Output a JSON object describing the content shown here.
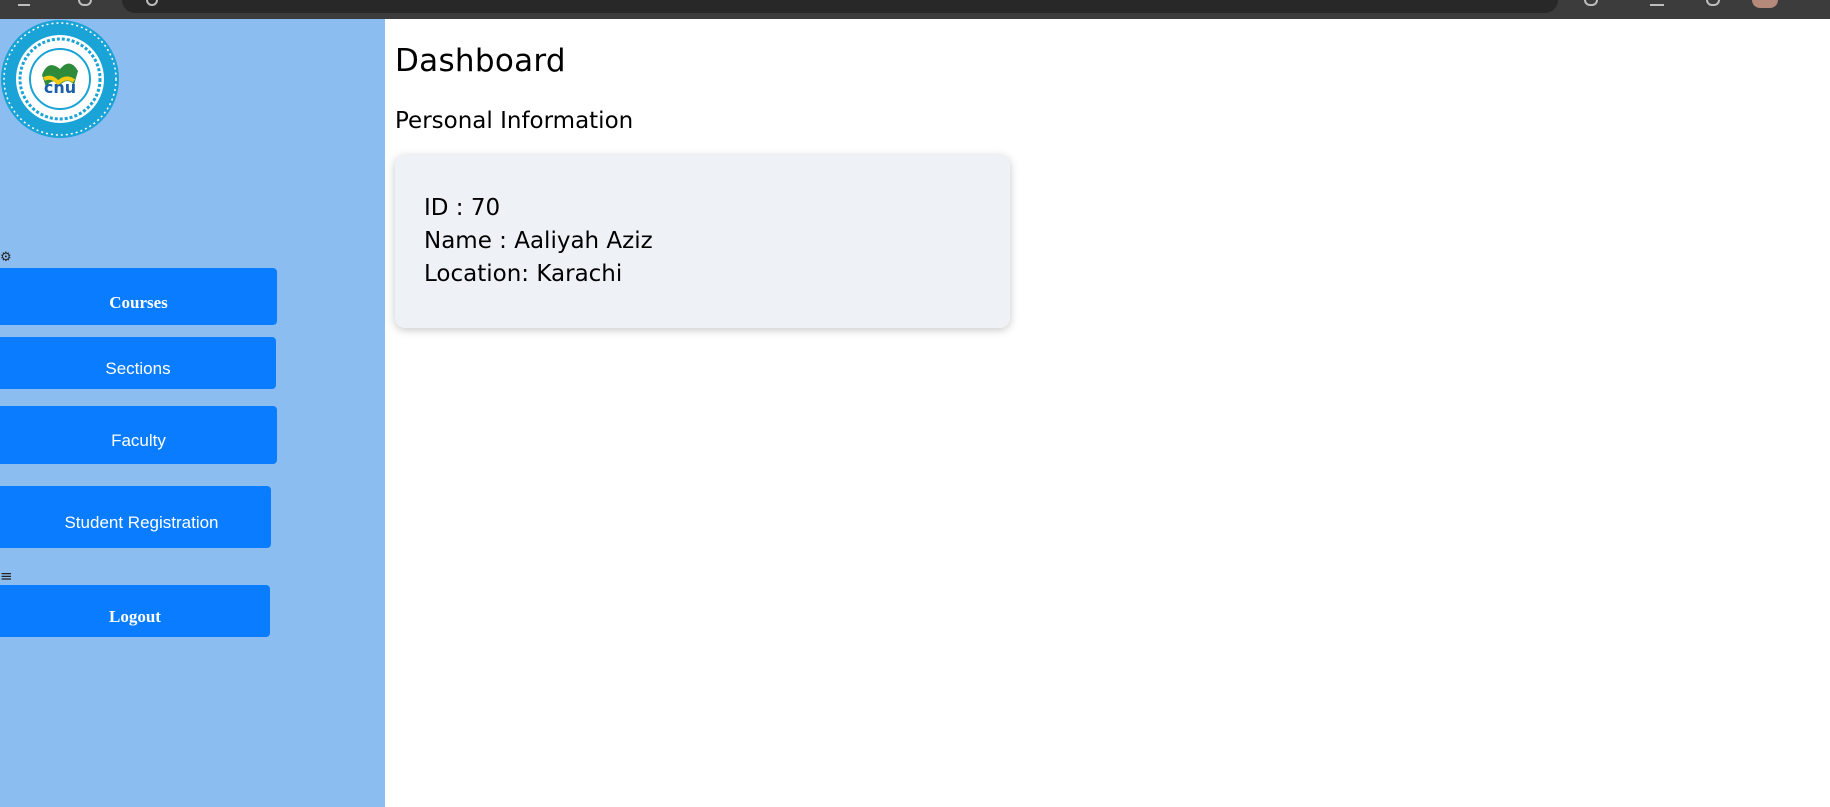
{
  "sidebar": {
    "logo_alt": "university-crest",
    "buttons": {
      "courses": "Courses",
      "sections": "Sections",
      "faculty": "Faculty",
      "student_registration": "Student Registration",
      "logout": "Logout"
    },
    "icons": [
      "grid-icon",
      "menu-icon"
    ]
  },
  "main": {
    "title": "Dashboard",
    "section_title": "Personal Information",
    "personal_info": {
      "id": "ID : 70",
      "name": "Name : Aaliyah Aziz",
      "location": "Location: Karachi"
    }
  },
  "colors": {
    "sidebar_bg": "#8bbdf0",
    "button_bg": "#0a7cff",
    "card_bg": "#eef2f7",
    "logo_blue": "#1aa3d6"
  }
}
